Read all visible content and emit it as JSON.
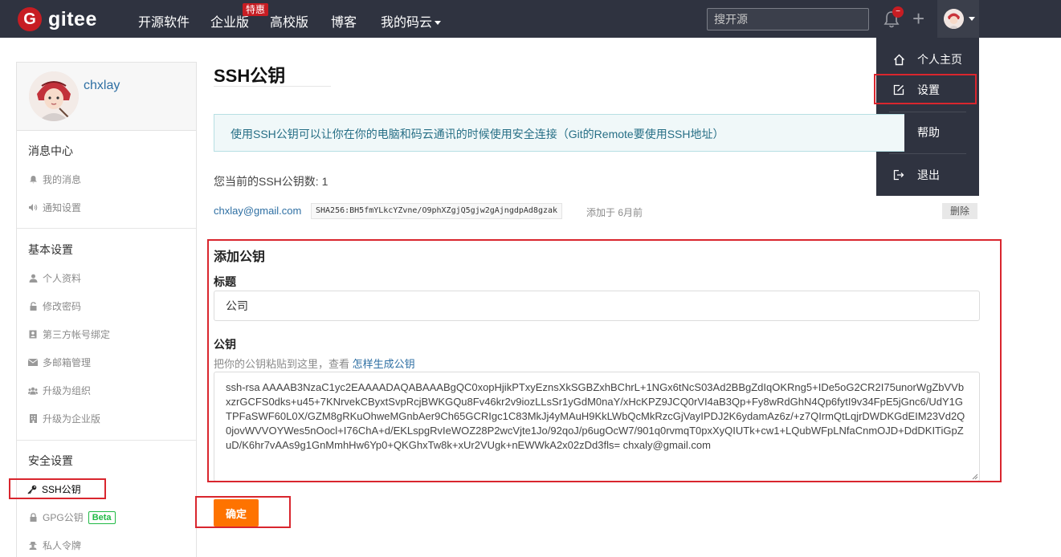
{
  "brand": {
    "mark": "G",
    "name": "gitee"
  },
  "nav": {
    "items": [
      "开源软件",
      "企业版",
      "高校版",
      "博客",
      "我的码云"
    ],
    "hot_tag": "特惠",
    "search_placeholder": "搜开源",
    "notification_count": "−"
  },
  "dropdown": {
    "items": [
      {
        "label": "个人主页",
        "icon": "home-icon"
      },
      {
        "label": "设置",
        "icon": "edit-icon"
      },
      {
        "label": "帮助",
        "icon": "help-icon"
      },
      {
        "label": "退出",
        "icon": "logout-icon"
      }
    ]
  },
  "sidebar": {
    "username": "chxlay",
    "groups": [
      {
        "title": "消息中心",
        "items": [
          {
            "label": "我的消息",
            "icon": "bell-icon"
          },
          {
            "label": "通知设置",
            "icon": "volume-icon"
          }
        ]
      },
      {
        "title": "基本设置",
        "items": [
          {
            "label": "个人资料",
            "icon": "user-icon"
          },
          {
            "label": "修改密码",
            "icon": "lock-icon"
          },
          {
            "label": "第三方帐号绑定",
            "icon": "contact-card-icon"
          },
          {
            "label": "多邮箱管理",
            "icon": "mail-icon"
          },
          {
            "label": "升级为组织",
            "icon": "users-icon"
          },
          {
            "label": "升级为企业版",
            "icon": "building-icon"
          }
        ]
      },
      {
        "title": "安全设置",
        "items": [
          {
            "label": "SSH公钥",
            "icon": "key-icon"
          },
          {
            "label": "GPG公钥",
            "icon": "lock-icon",
            "badge": "Beta"
          },
          {
            "label": "私人令牌",
            "icon": "user-secret-icon"
          }
        ]
      }
    ]
  },
  "main": {
    "title": "SSH公钥",
    "info": "使用SSH公钥可以让你在你的电脑和码云通讯的时候使用安全连接（Git的Remote要使用SSH地址）",
    "count_text": "您当前的SSH公钥数: 1",
    "key": {
      "email": "chxlay@gmail.com",
      "fingerprint": "SHA256:BH5fmYLkcYZvne/O9phXZgjQ5gjw2gAjngdpAd8gzak",
      "added": "添加于 6月前",
      "delete_label": "删除"
    },
    "add": {
      "heading": "添加公钥",
      "title_label": "标题",
      "title_value": "公司",
      "key_label": "公钥",
      "hint_text": "把你的公钥粘贴到这里，查看 ",
      "hint_link": "怎样生成公钥",
      "key_value": "ssh-rsa AAAAB3NzaC1yc2EAAAADAQABAAABgQC0xopHjikPTxyEznsXkSGBZxhBChrL+1NGx6tNcS03Ad2BBgZdIqOKRng5+IDe5oG2CR2I75unorWgZbVVbxzrGCFS0dks+u45+7KNrvekCByxtSvpRcjBWKGQu8Fv46kr2v9iozLLsSr1yGdM0naY/xHcKPZ9JCQ0rVI4aB3Qp+Fy8wRdGhN4Qp6fytI9v34FpE5jGnc6/UdY1GTPFaSWF60L0X/GZM8gRKuOhweMGnbAer9Ch65GCRIgc1C83MkJj4yMAuH9KkLWbQcMkRzcGjVayIPDJ2K6ydamAz6z/+z7QIrmQtLqjrDWDKGdEIM23Vd2Q0jovWVVOYWes5nOocl+I76ChA+d/EKLspgRvIeWOZ28P2wcVjte1Jo/92qoJ/p6ugOcW7/901q0rvmqT0pxXyQIUTk+cw1+LQubWFpLNfaCnmOJD+DdDKITiGpZuD/K6hr7vAAs9g1GnMmhHw6Yp0+QKGhxTw8k+xUr2VUgk+nEWWkA2x02zDd3fls= chxaly@gmail.com",
      "submit_label": "确定"
    }
  },
  "colors": {
    "accent": "#fe7300",
    "brand": "#c71d23",
    "nav_bg": "#2f3340",
    "annotation": "#d9262e"
  }
}
